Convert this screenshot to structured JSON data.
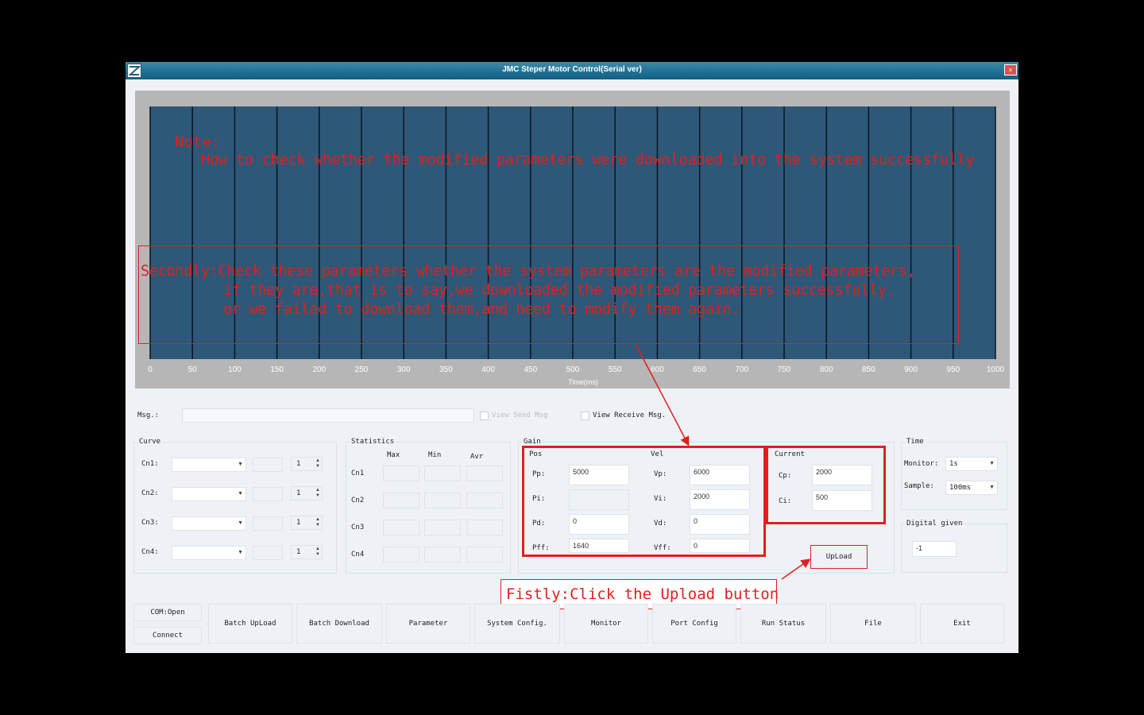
{
  "window": {
    "title": "JMC Steper Motor  Control(Serial ver)",
    "close_glyph": "×",
    "icon": "app-logo-icon"
  },
  "chart_data": {
    "type": "line",
    "title": "",
    "xlabel": "Time(ms)",
    "ylabel": "",
    "xlim": [
      0,
      1000
    ],
    "x_ticks": [
      0,
      50,
      100,
      150,
      200,
      250,
      300,
      350,
      400,
      450,
      500,
      550,
      600,
      650,
      700,
      750,
      800,
      850,
      900,
      950,
      1000
    ],
    "grid": true,
    "series": [],
    "plot_bg": "#2e5878",
    "grid_color": "#0b1520",
    "tick_color": "#ffffff"
  },
  "overlay": {
    "note_title": "Note:",
    "note_text": "How to check whether the modified parameters were downloaded into the system successfully",
    "second_line1": "Secondly:Check these parameters whether the system parameters are the modified parameters,",
    "second_line2": "if they are,that is to say,we downloaded the modified parameters successfully.",
    "second_line3": "or we failed to download them,and need to modify them again.",
    "callout": "Fistly:Click the Upload button",
    "color": "#e0201c"
  },
  "msg": {
    "label": "Msg.:",
    "value": "",
    "view_send": "View Send Msg",
    "view_receive": "View Receive Msg."
  },
  "curve": {
    "title": "Curve",
    "rows": [
      {
        "label": "Cn1:",
        "spin": "1"
      },
      {
        "label": "Cn2:",
        "spin": "1"
      },
      {
        "label": "Cn3:",
        "spin": "1"
      },
      {
        "label": "Cn4:",
        "spin": "1"
      }
    ]
  },
  "statistics": {
    "title": "Statistics",
    "headers": [
      "Max",
      "Min",
      "Avr"
    ],
    "rows": [
      "Cn1",
      "Cn2",
      "Cn3",
      "Cn4"
    ]
  },
  "gain": {
    "title": "Gain",
    "pos": {
      "title": "Pos",
      "fields": [
        {
          "label": "Pp:",
          "value": "5000"
        },
        {
          "label": "Pi:",
          "value": ""
        },
        {
          "label": "Pd:",
          "value": "0"
        },
        {
          "label": "Pff:",
          "value": "1640"
        }
      ]
    },
    "vel": {
      "title": "Vel",
      "fields": [
        {
          "label": "Vp:",
          "value": "6000"
        },
        {
          "label": "Vi:",
          "value": "2000"
        },
        {
          "label": "Vd:",
          "value": "0"
        },
        {
          "label": "Vff:",
          "value": "0"
        }
      ]
    }
  },
  "current": {
    "title": "Current",
    "fields": [
      {
        "label": "Cp:",
        "value": "2000"
      },
      {
        "label": "Ci:",
        "value": "500"
      }
    ]
  },
  "upload_label": "UpLoad",
  "time": {
    "title": "Time",
    "monitor_label": "Monitor:",
    "monitor_value": "1s",
    "sample_label": "Sample:",
    "sample_value": "100ms"
  },
  "digital": {
    "title": "Digital given",
    "value": "-1"
  },
  "toolbar": {
    "com_open": "COM:Open",
    "connect": "Connect",
    "buttons": [
      "Batch UpLoad",
      "Batch Download",
      "Parameter",
      "System Config.",
      "Monitor",
      "Port Config",
      "Run Status",
      "File",
      "Exit"
    ]
  }
}
